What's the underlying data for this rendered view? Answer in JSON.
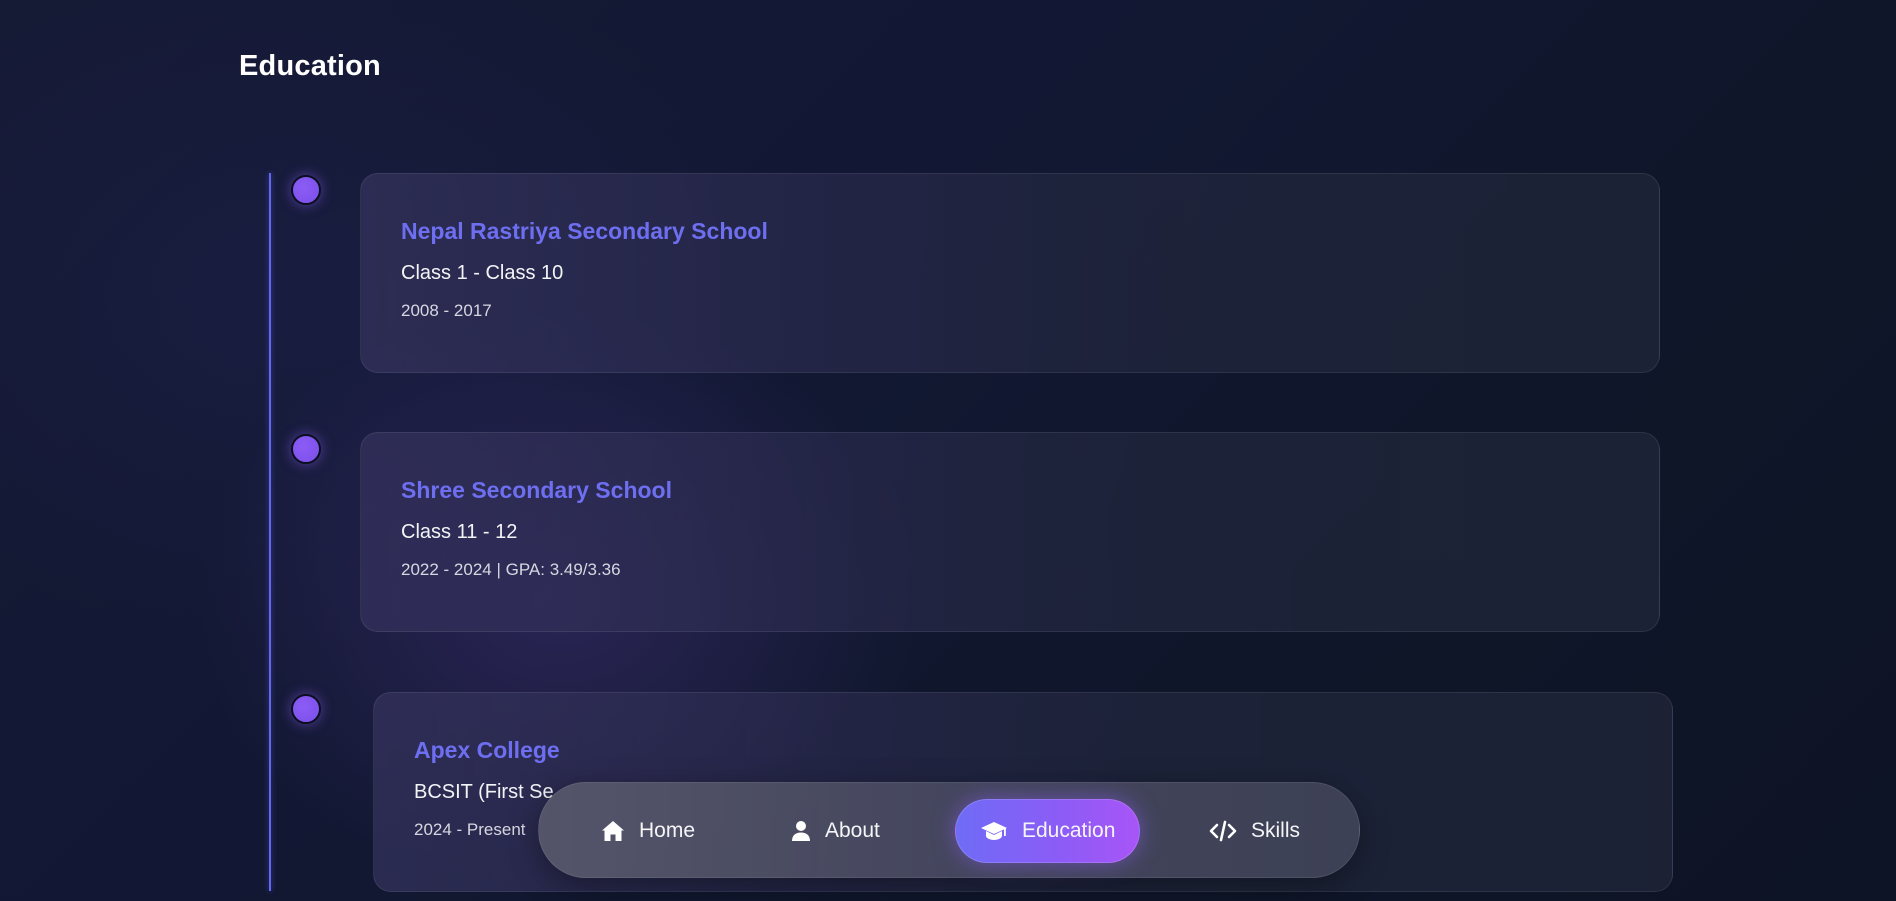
{
  "section": {
    "title": "Education"
  },
  "timeline": {
    "line_color": "#6366f1",
    "dot_color": "#8b5cf6",
    "items": [
      {
        "school": "Nepal Rastriya Secondary School",
        "level": "Class 1 - Class 10",
        "meta": "2008 - 2017"
      },
      {
        "school": "Shree Secondary School",
        "level": "Class 11 - 12",
        "meta": "2022 - 2024 | GPA: 3.49/3.36"
      },
      {
        "school": "Apex College",
        "level": "BCSIT (First Se",
        "meta": "2024 - Present"
      }
    ]
  },
  "nav": {
    "active_gradient": [
      "#6f6cf6",
      "#a855f7"
    ],
    "items": [
      {
        "label": "Home",
        "icon": "home-icon"
      },
      {
        "label": "About",
        "icon": "user-icon"
      },
      {
        "label": "Education",
        "icon": "graduation-cap-icon",
        "active": true
      },
      {
        "label": "Skills",
        "icon": "code-icon"
      }
    ]
  }
}
